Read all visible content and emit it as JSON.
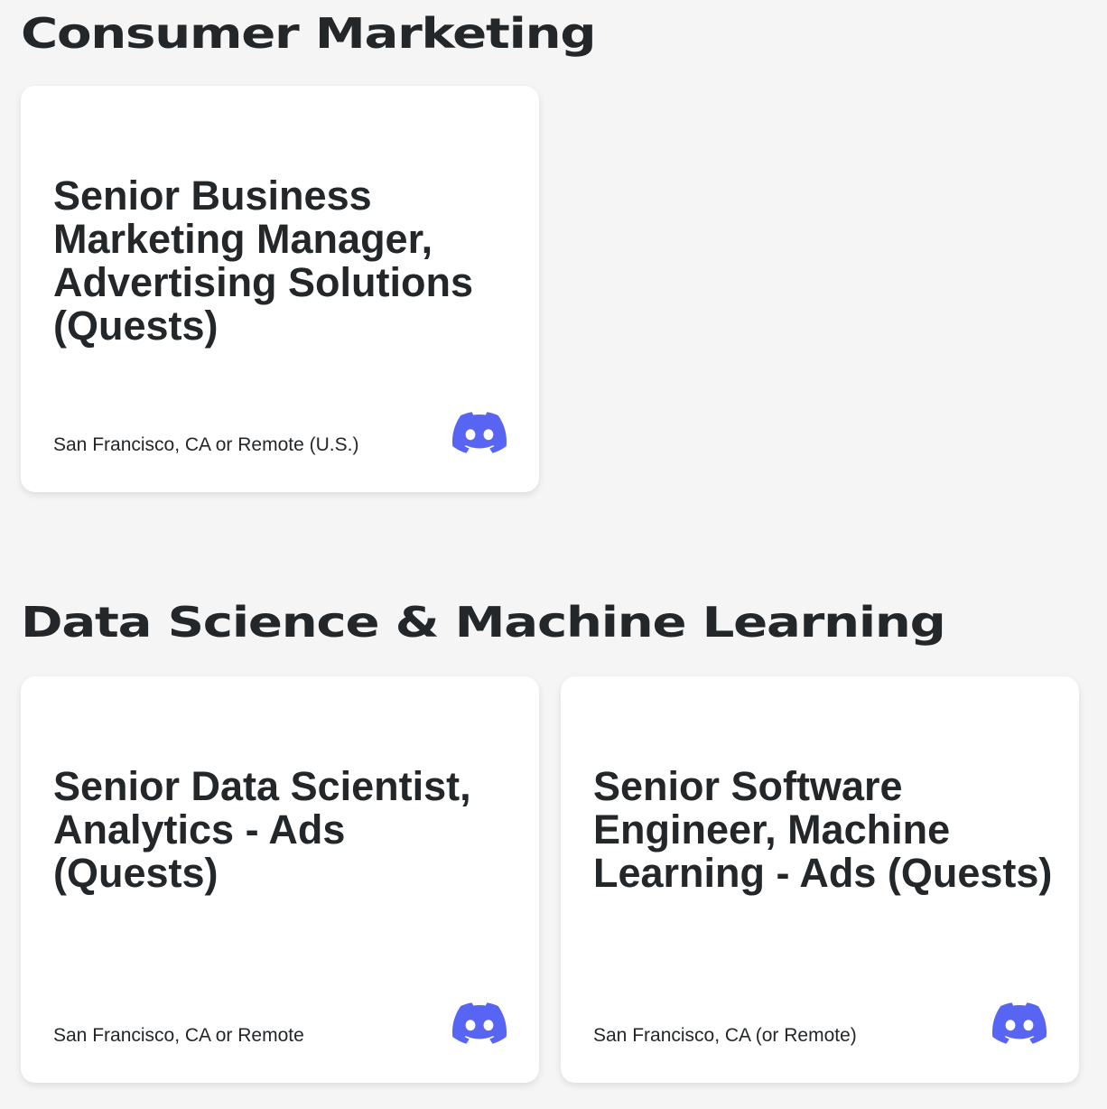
{
  "colors": {
    "background": "#f5f5f5",
    "card": "#ffffff",
    "text": "#23272a",
    "blurple": "#5865f2"
  },
  "sections": [
    {
      "title": "Consumer Marketing",
      "jobs": [
        {
          "title": "Senior Business Marketing Manager, Advertising Solutions (Quests)",
          "location": "San Francisco, CA or Remote (U.S.)",
          "icon": "discord-logo-icon"
        }
      ]
    },
    {
      "title": "Data Science & Machine Learning",
      "jobs": [
        {
          "title": "Senior Data Scientist, Analytics - Ads (Quests)",
          "location": "San Francisco, CA or Remote",
          "icon": "discord-logo-icon"
        },
        {
          "title": "Senior Software Engineer, Machine Learning - Ads (Quests)",
          "location": "San Francisco, CA (or Remote)",
          "icon": "discord-logo-icon"
        }
      ]
    }
  ]
}
